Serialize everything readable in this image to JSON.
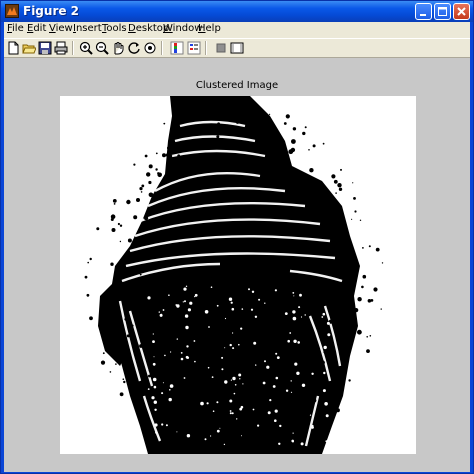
{
  "window": {
    "title": "Figure 2"
  },
  "menu": [
    {
      "label": "File",
      "acc": "F",
      "rest": "ile"
    },
    {
      "label": "Edit",
      "acc": "E",
      "rest": "dit"
    },
    {
      "label": "View",
      "acc": "V",
      "rest": "iew"
    },
    {
      "label": "Insert",
      "acc": "I",
      "rest": "nsert"
    },
    {
      "label": "Tools",
      "acc": "T",
      "rest": "ools"
    },
    {
      "label": "Desktop",
      "acc": "D",
      "rest": "esktop"
    },
    {
      "label": "Window",
      "acc": "W",
      "rest": "indow"
    },
    {
      "label": "Help",
      "acc": "H",
      "rest": "elp"
    }
  ],
  "toolbar": {
    "icons": [
      "new-figure-icon",
      "open-file-icon",
      "save-figure-icon",
      "print-figure-icon",
      "zoom-in-icon",
      "zoom-out-icon",
      "pan-icon",
      "rotate-3d-icon",
      "data-cursor-icon",
      "insert-colorbar-icon",
      "insert-legend-icon",
      "hide-plot-tools-icon",
      "show-plot-tools-icon"
    ]
  },
  "axes": {
    "title": "Clustered Image",
    "image": "black-and-white clustered fingerprint"
  },
  "colors": {
    "titlebar": "#0a58e8",
    "figure_background": "#c8c8c8",
    "foreground": "#000000",
    "background": "#ffffff"
  }
}
